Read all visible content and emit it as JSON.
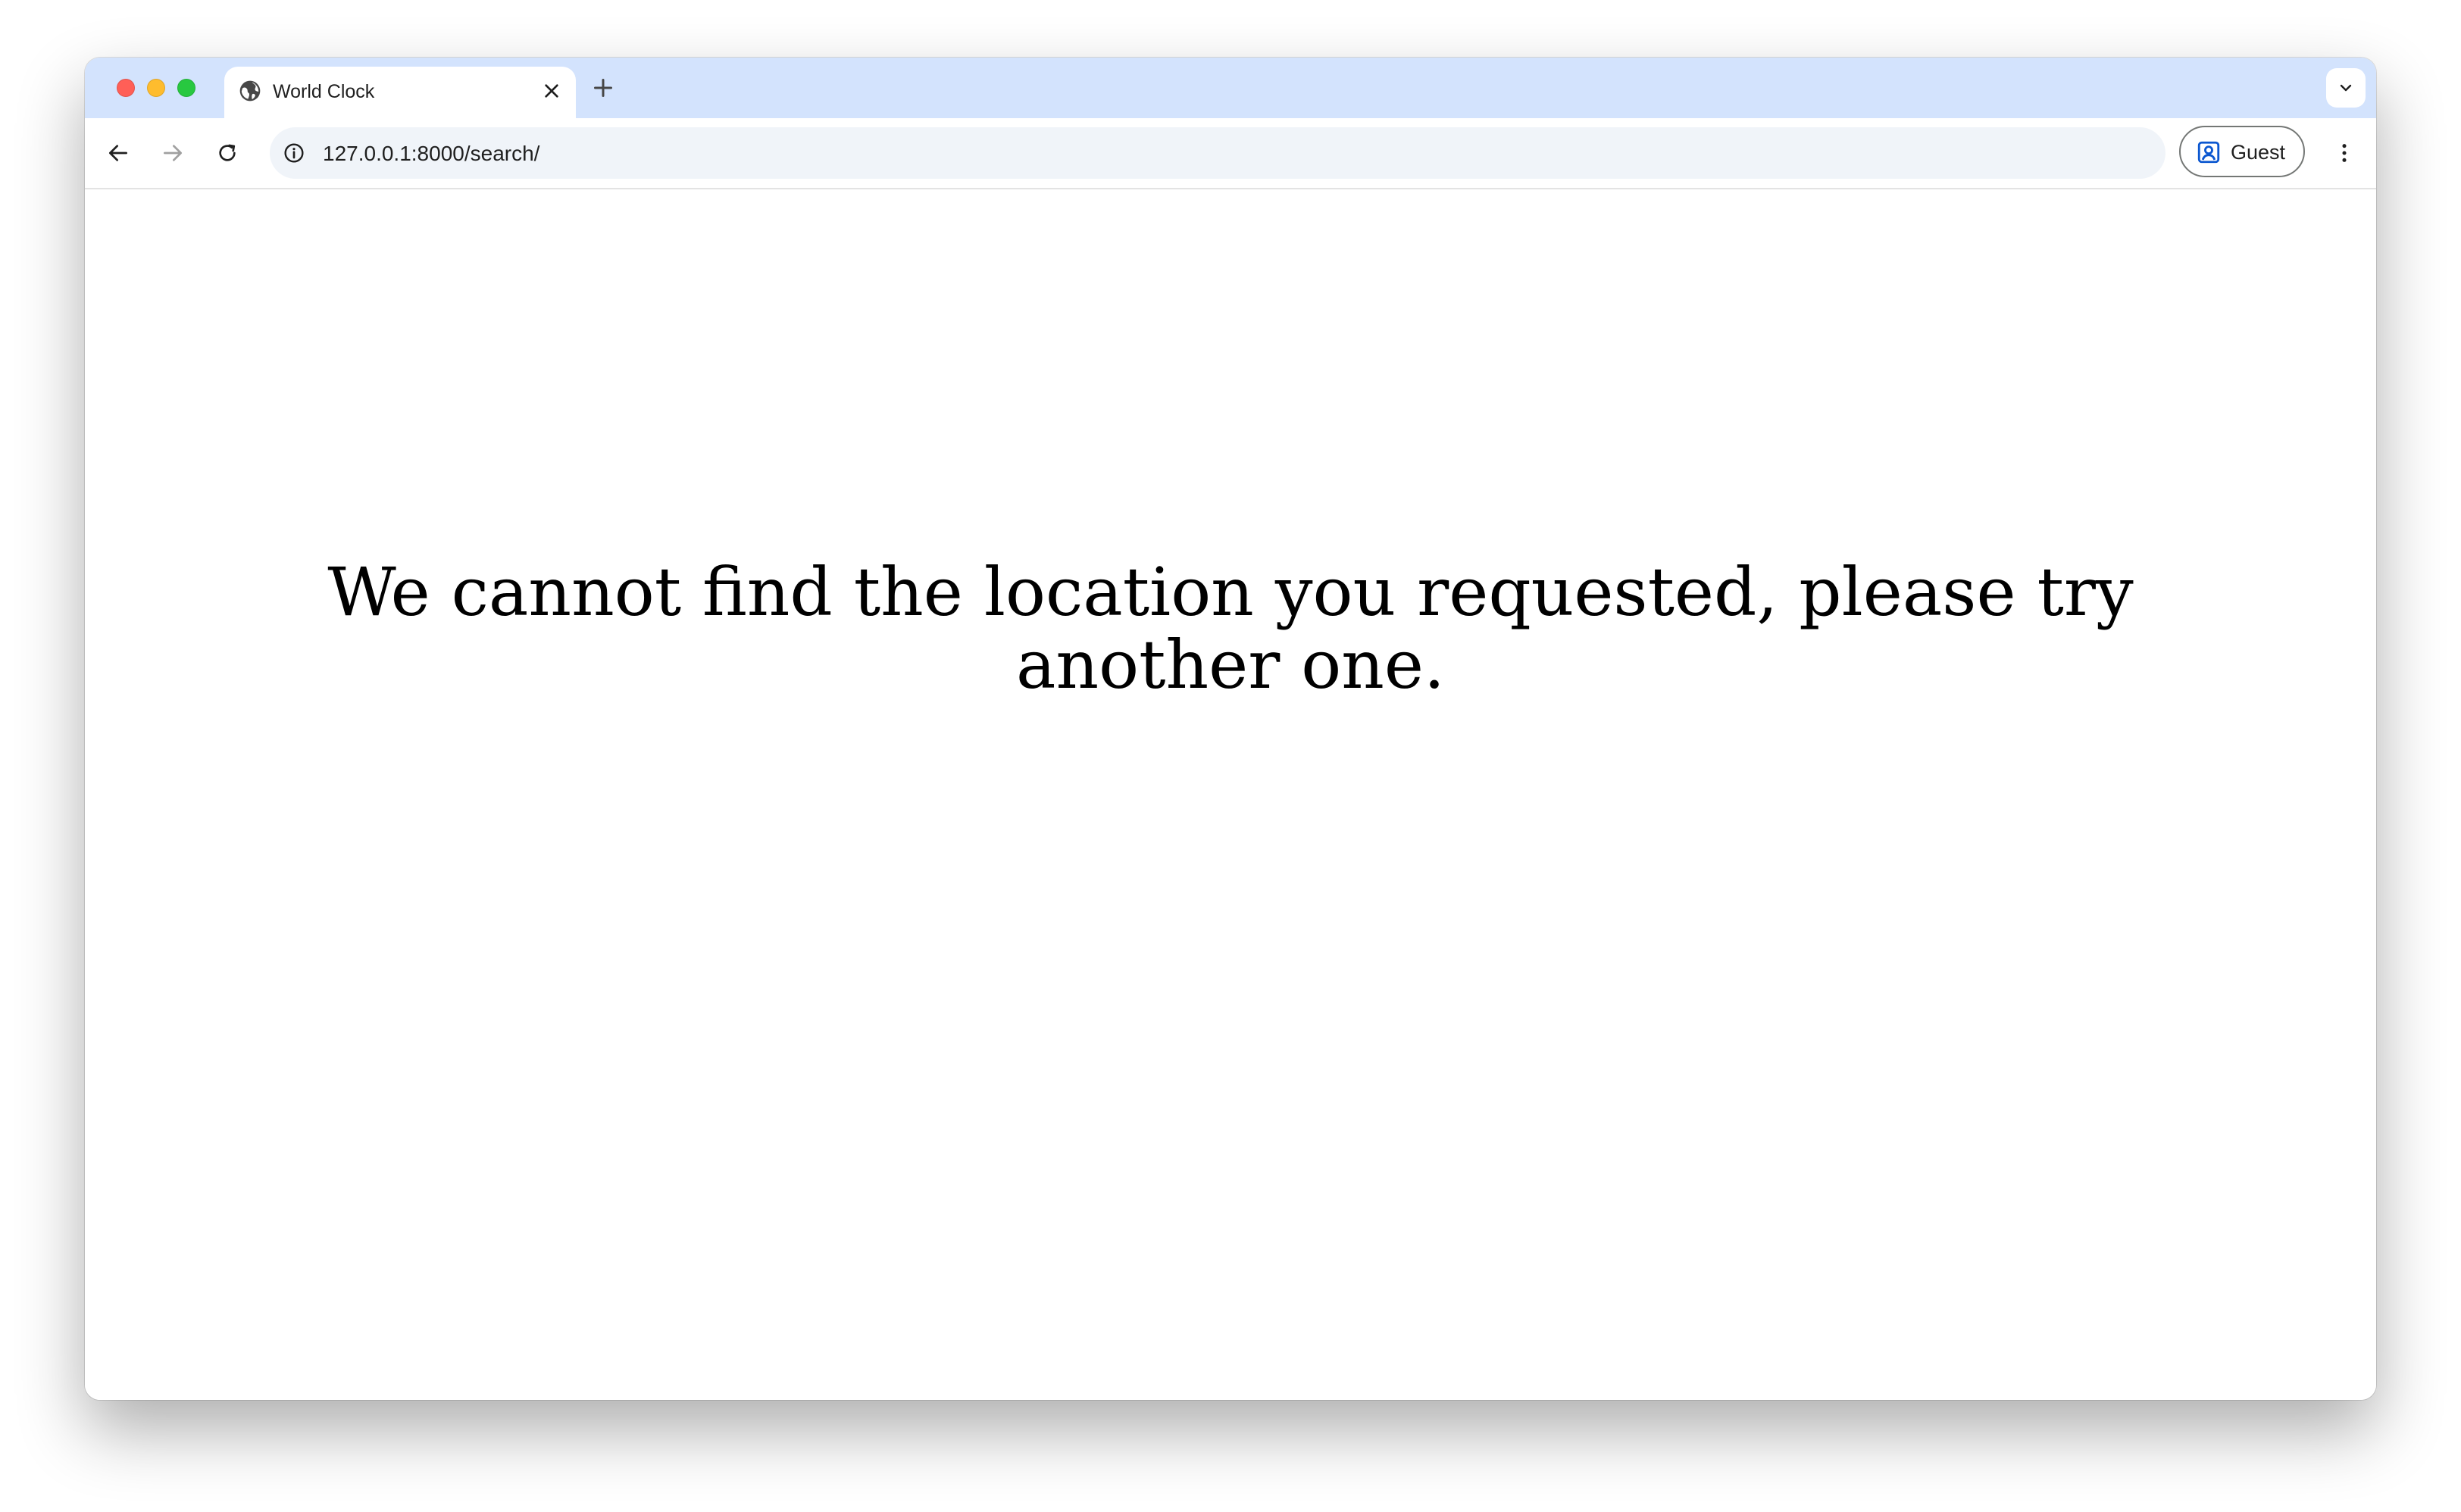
{
  "browser": {
    "tab": {
      "title": "World Clock"
    },
    "address_bar": {
      "url": "127.0.0.1:8000/search/"
    },
    "profile": {
      "label": "Guest"
    },
    "icons": {
      "favicon": "globe-icon",
      "tab_close": "close-icon",
      "new_tab": "plus-icon",
      "tab_search": "chevron-down-icon",
      "back": "arrow-left-icon",
      "forward": "arrow-right-icon",
      "reload": "reload-icon",
      "site_info": "info-icon",
      "profile": "person-badge-icon",
      "menu": "more-vertical-icon"
    },
    "colors": {
      "tabbar_bg": "#d3e3fd",
      "omnibox_bg": "#f0f4f9",
      "close_red": "#ff5f57",
      "minimize_yellow": "#febc2e",
      "zoom_green": "#28c840"
    }
  },
  "page": {
    "message": "We cannot find the location you requested, please try another one."
  }
}
